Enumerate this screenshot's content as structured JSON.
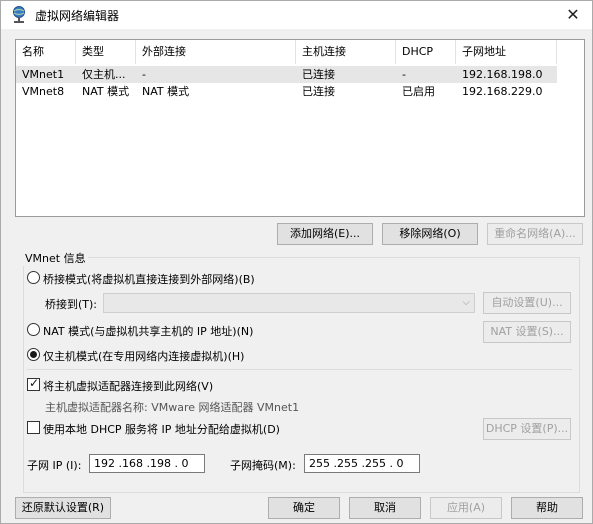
{
  "window": {
    "title": "虚拟网络编辑器",
    "close_symbol": "✕"
  },
  "table": {
    "headers": [
      "名称",
      "类型",
      "外部连接",
      "主机连接",
      "DHCP",
      "子网地址"
    ],
    "rows": [
      [
        "VMnet1",
        "仅主机...",
        "-",
        "已连接",
        "-",
        "192.168.198.0"
      ],
      [
        "VMnet8",
        "NAT 模式",
        "NAT 模式",
        "已连接",
        "已启用",
        "192.168.229.0"
      ]
    ],
    "selected_row": 0
  },
  "network_buttons": {
    "add": "添加网络(E)...",
    "remove": "移除网络(O)",
    "rename": "重命名网络(A)..."
  },
  "vmnet_info": {
    "group_label": "VMnet 信息",
    "bridged_label": "桥接模式(将虚拟机直接连接到外部网络)(B)",
    "bridge_to_label": "桥接到(T):",
    "bridge_to_value": "",
    "auto_settings": "自动设置(U)...",
    "nat_label": "NAT 模式(与虚拟机共享主机的 IP 地址)(N)",
    "nat_settings": "NAT 设置(S)...",
    "hostonly_label": "仅主机模式(在专用网络内连接虚拟机)(H)",
    "selected_mode": "host-only",
    "connect_adapter_label": "将主机虚拟适配器连接到此网络(V)",
    "connect_adapter_checked": true,
    "adapter_name_text": "主机虚拟适配器名称: VMware 网络适配器 VMnet1",
    "dhcp_label": "使用本地 DHCP 服务将 IP 地址分配给虚拟机(D)",
    "dhcp_checked": false,
    "dhcp_settings": "DHCP 设置(P)...",
    "subnet_ip_label": "子网 IP (I):",
    "subnet_ip_value": "192 .168 .198 . 0",
    "subnet_mask_label": "子网掩码(M):",
    "subnet_mask_value": "255 .255 .255 . 0"
  },
  "footer": {
    "restore": "还原默认设置(R)",
    "ok": "确定",
    "cancel": "取消",
    "apply": "应用(A)",
    "help": "帮助"
  },
  "colors": {
    "selection": "#e6e6e6",
    "button_bg": "#e1e1e1",
    "window_bg": "#f0f0f0"
  },
  "icons": {
    "title": "network-globe-icon",
    "combo": "chevron-down-icon"
  }
}
